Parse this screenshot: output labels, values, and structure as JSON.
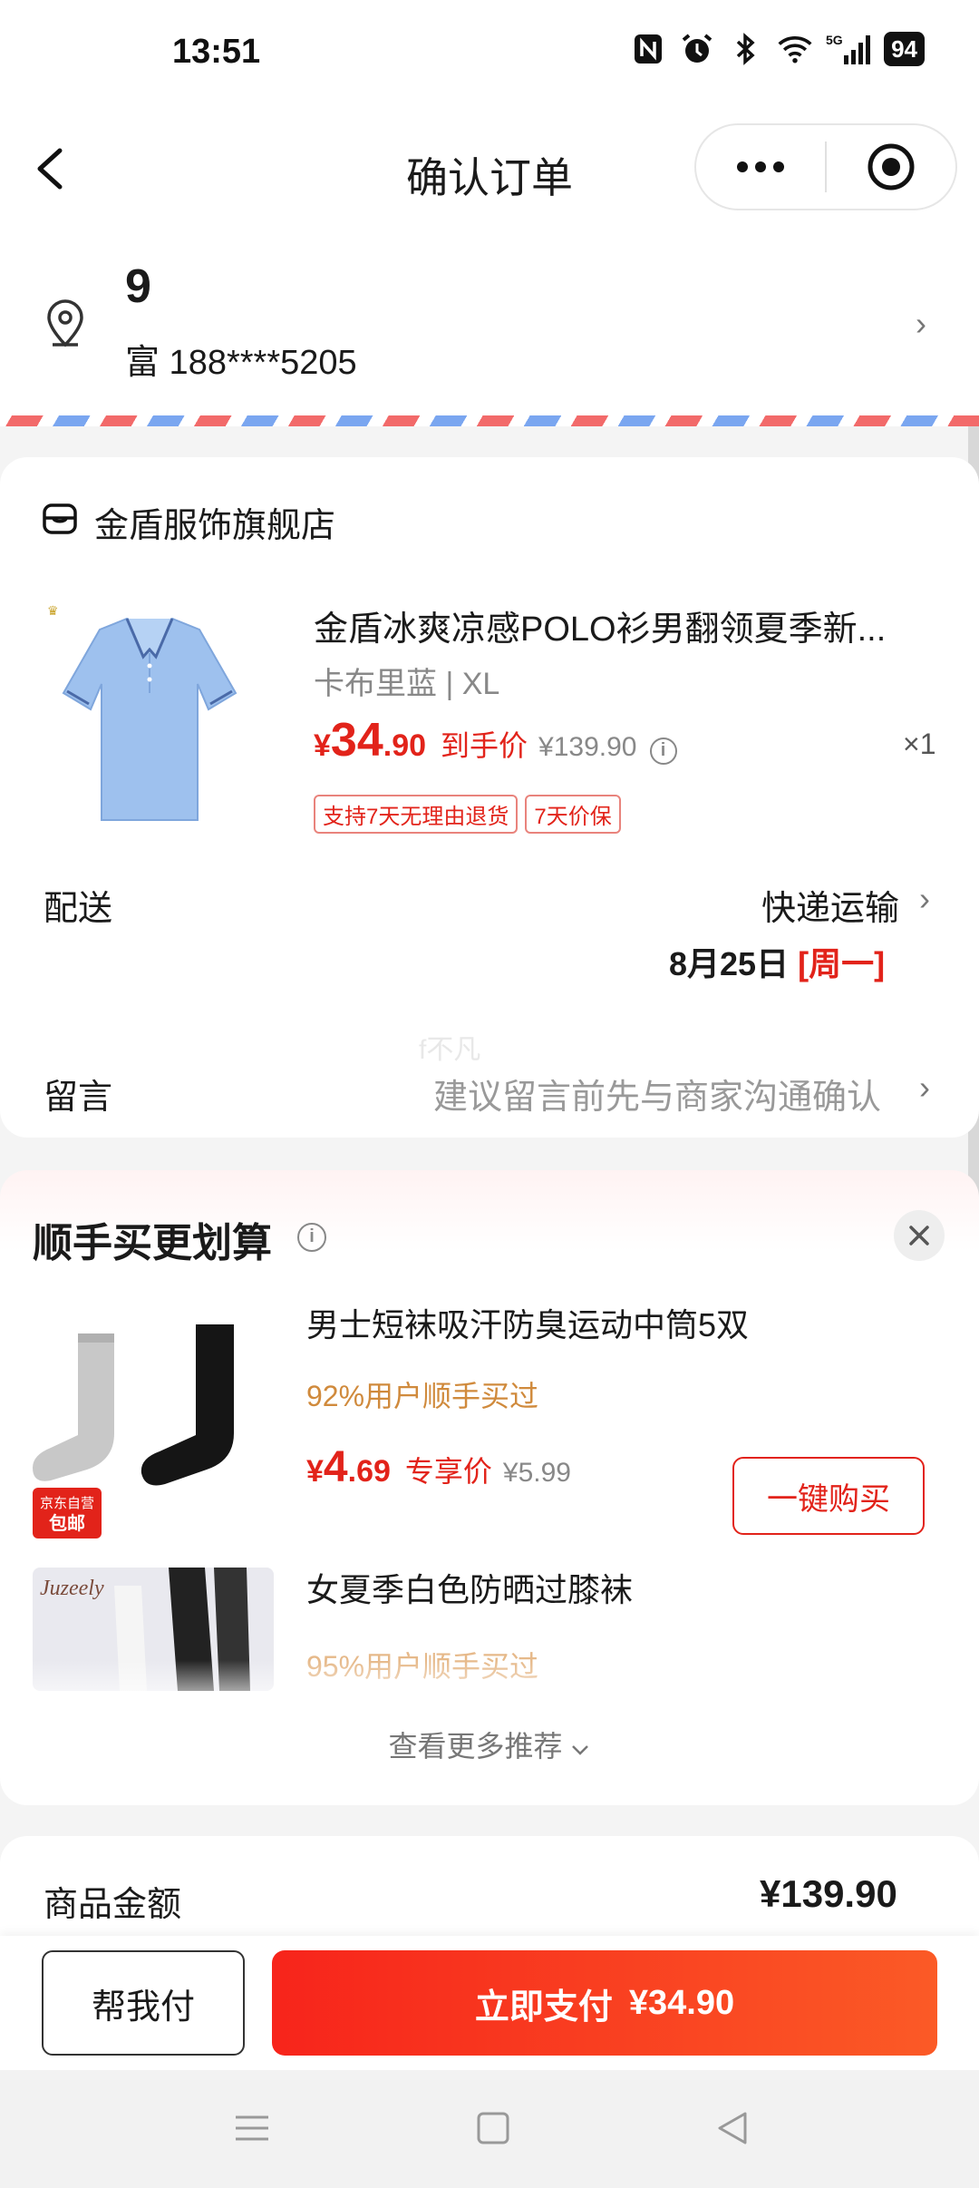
{
  "status_bar": {
    "time": "13:51",
    "battery": "94",
    "network": "5G"
  },
  "nav": {
    "title": "确认订单"
  },
  "address": {
    "name": "9",
    "phone": "富 188****5205",
    "arrow": "›"
  },
  "shop": {
    "name": "金盾服饰旗舰店",
    "product": {
      "title": "金盾冰爽凉感POLO衫男翻领夏季新...",
      "spec": "卡布里蓝 | XL",
      "price_yen": "¥",
      "price_int": "34",
      "price_dec": ".90",
      "price_note": "到手价",
      "original_price": "¥139.90",
      "info": "i",
      "quantity": "×1",
      "tags": [
        "支持7天无理由退货",
        "7天价保"
      ]
    },
    "shipping": {
      "label": "配送",
      "value": "快递运输",
      "date": "8月25日 ",
      "day": "[周一]",
      "arrow": "›"
    },
    "message": {
      "label": "留言",
      "placeholder": "建议留言前先与商家沟通确认",
      "arrow": "›"
    },
    "watermark": "f不凡"
  },
  "recommend": {
    "title": "顺手买更划算",
    "info": "i",
    "items": [
      {
        "title": "男士短袜吸汗防臭运动中筒5双",
        "percent": "92%用户顺手买过",
        "price_yen": "¥",
        "price_int": "4",
        "price_dec": ".69",
        "price_note": "专享价",
        "original_price": "¥5.99",
        "button": "一键购买",
        "badge_top": "京东自营",
        "badge_bottom": "包邮"
      },
      {
        "title": "女夏季白色防晒过膝袜",
        "percent": "95%用户顺手买过",
        "brand": "Juzeely"
      }
    ],
    "more": "查看更多推荐"
  },
  "amount": {
    "label": "商品金额",
    "value": "¥139.90"
  },
  "bottom": {
    "help_pay": "帮我付",
    "pay_label": "立即支付",
    "pay_amount": "¥34.90"
  },
  "colors": {
    "accent": "#e2231a",
    "pay_start": "#f7241b",
    "pay_end": "#fb5a26",
    "gold": "#d08a3c"
  }
}
